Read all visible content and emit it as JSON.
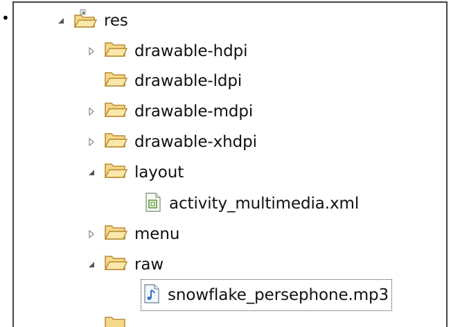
{
  "tree": {
    "bullet": "•",
    "items": [
      {
        "label": "res",
        "expanded": true,
        "icon": "source-folder-icon"
      },
      {
        "label": "drawable-hdpi",
        "expanded": false,
        "icon": "folder-icon"
      },
      {
        "label": "drawable-ldpi",
        "expanded": null,
        "icon": "folder-icon"
      },
      {
        "label": "drawable-mdpi",
        "expanded": false,
        "icon": "folder-icon"
      },
      {
        "label": "drawable-xhdpi",
        "expanded": false,
        "icon": "folder-icon"
      },
      {
        "label": "layout",
        "expanded": true,
        "icon": "folder-icon"
      },
      {
        "label": "activity_multimedia.xml",
        "expanded": null,
        "icon": "xml-file-icon"
      },
      {
        "label": "menu",
        "expanded": false,
        "icon": "folder-icon"
      },
      {
        "label": "raw",
        "expanded": true,
        "icon": "folder-icon"
      },
      {
        "label": "snowflake_persephone.mp3",
        "expanded": null,
        "icon": "audio-file-icon",
        "selected": true
      }
    ]
  },
  "colors": {
    "folder_fill": "#f6d88a",
    "folder_stroke": "#b88a2e",
    "toggle_color": "#555555",
    "selection_outline": "#333333"
  }
}
